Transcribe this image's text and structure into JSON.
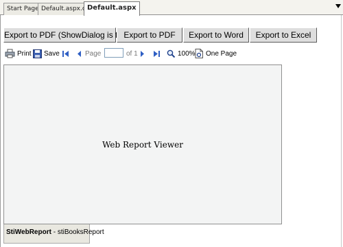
{
  "tabs": [
    {
      "label": "Start Page"
    },
    {
      "label": "Default.aspx.cs"
    },
    {
      "label": "Default.aspx"
    }
  ],
  "export_buttons": [
    {
      "label": "Export to PDF (ShowDialog is false)"
    },
    {
      "label": "Export to PDF"
    },
    {
      "label": "Export to Word"
    },
    {
      "label": "Export to Excel"
    }
  ],
  "toolbar": {
    "print_label": "Print",
    "save_label": "Save",
    "page_label": "Page",
    "page_value": "",
    "of_label": "of 1",
    "zoom_label": "100%",
    "view_mode_label": "One Page"
  },
  "viewer": {
    "placeholder_text": "Web Report Viewer"
  },
  "component": {
    "name": "StiWebReport",
    "suffix": " - stiBooksReport"
  }
}
